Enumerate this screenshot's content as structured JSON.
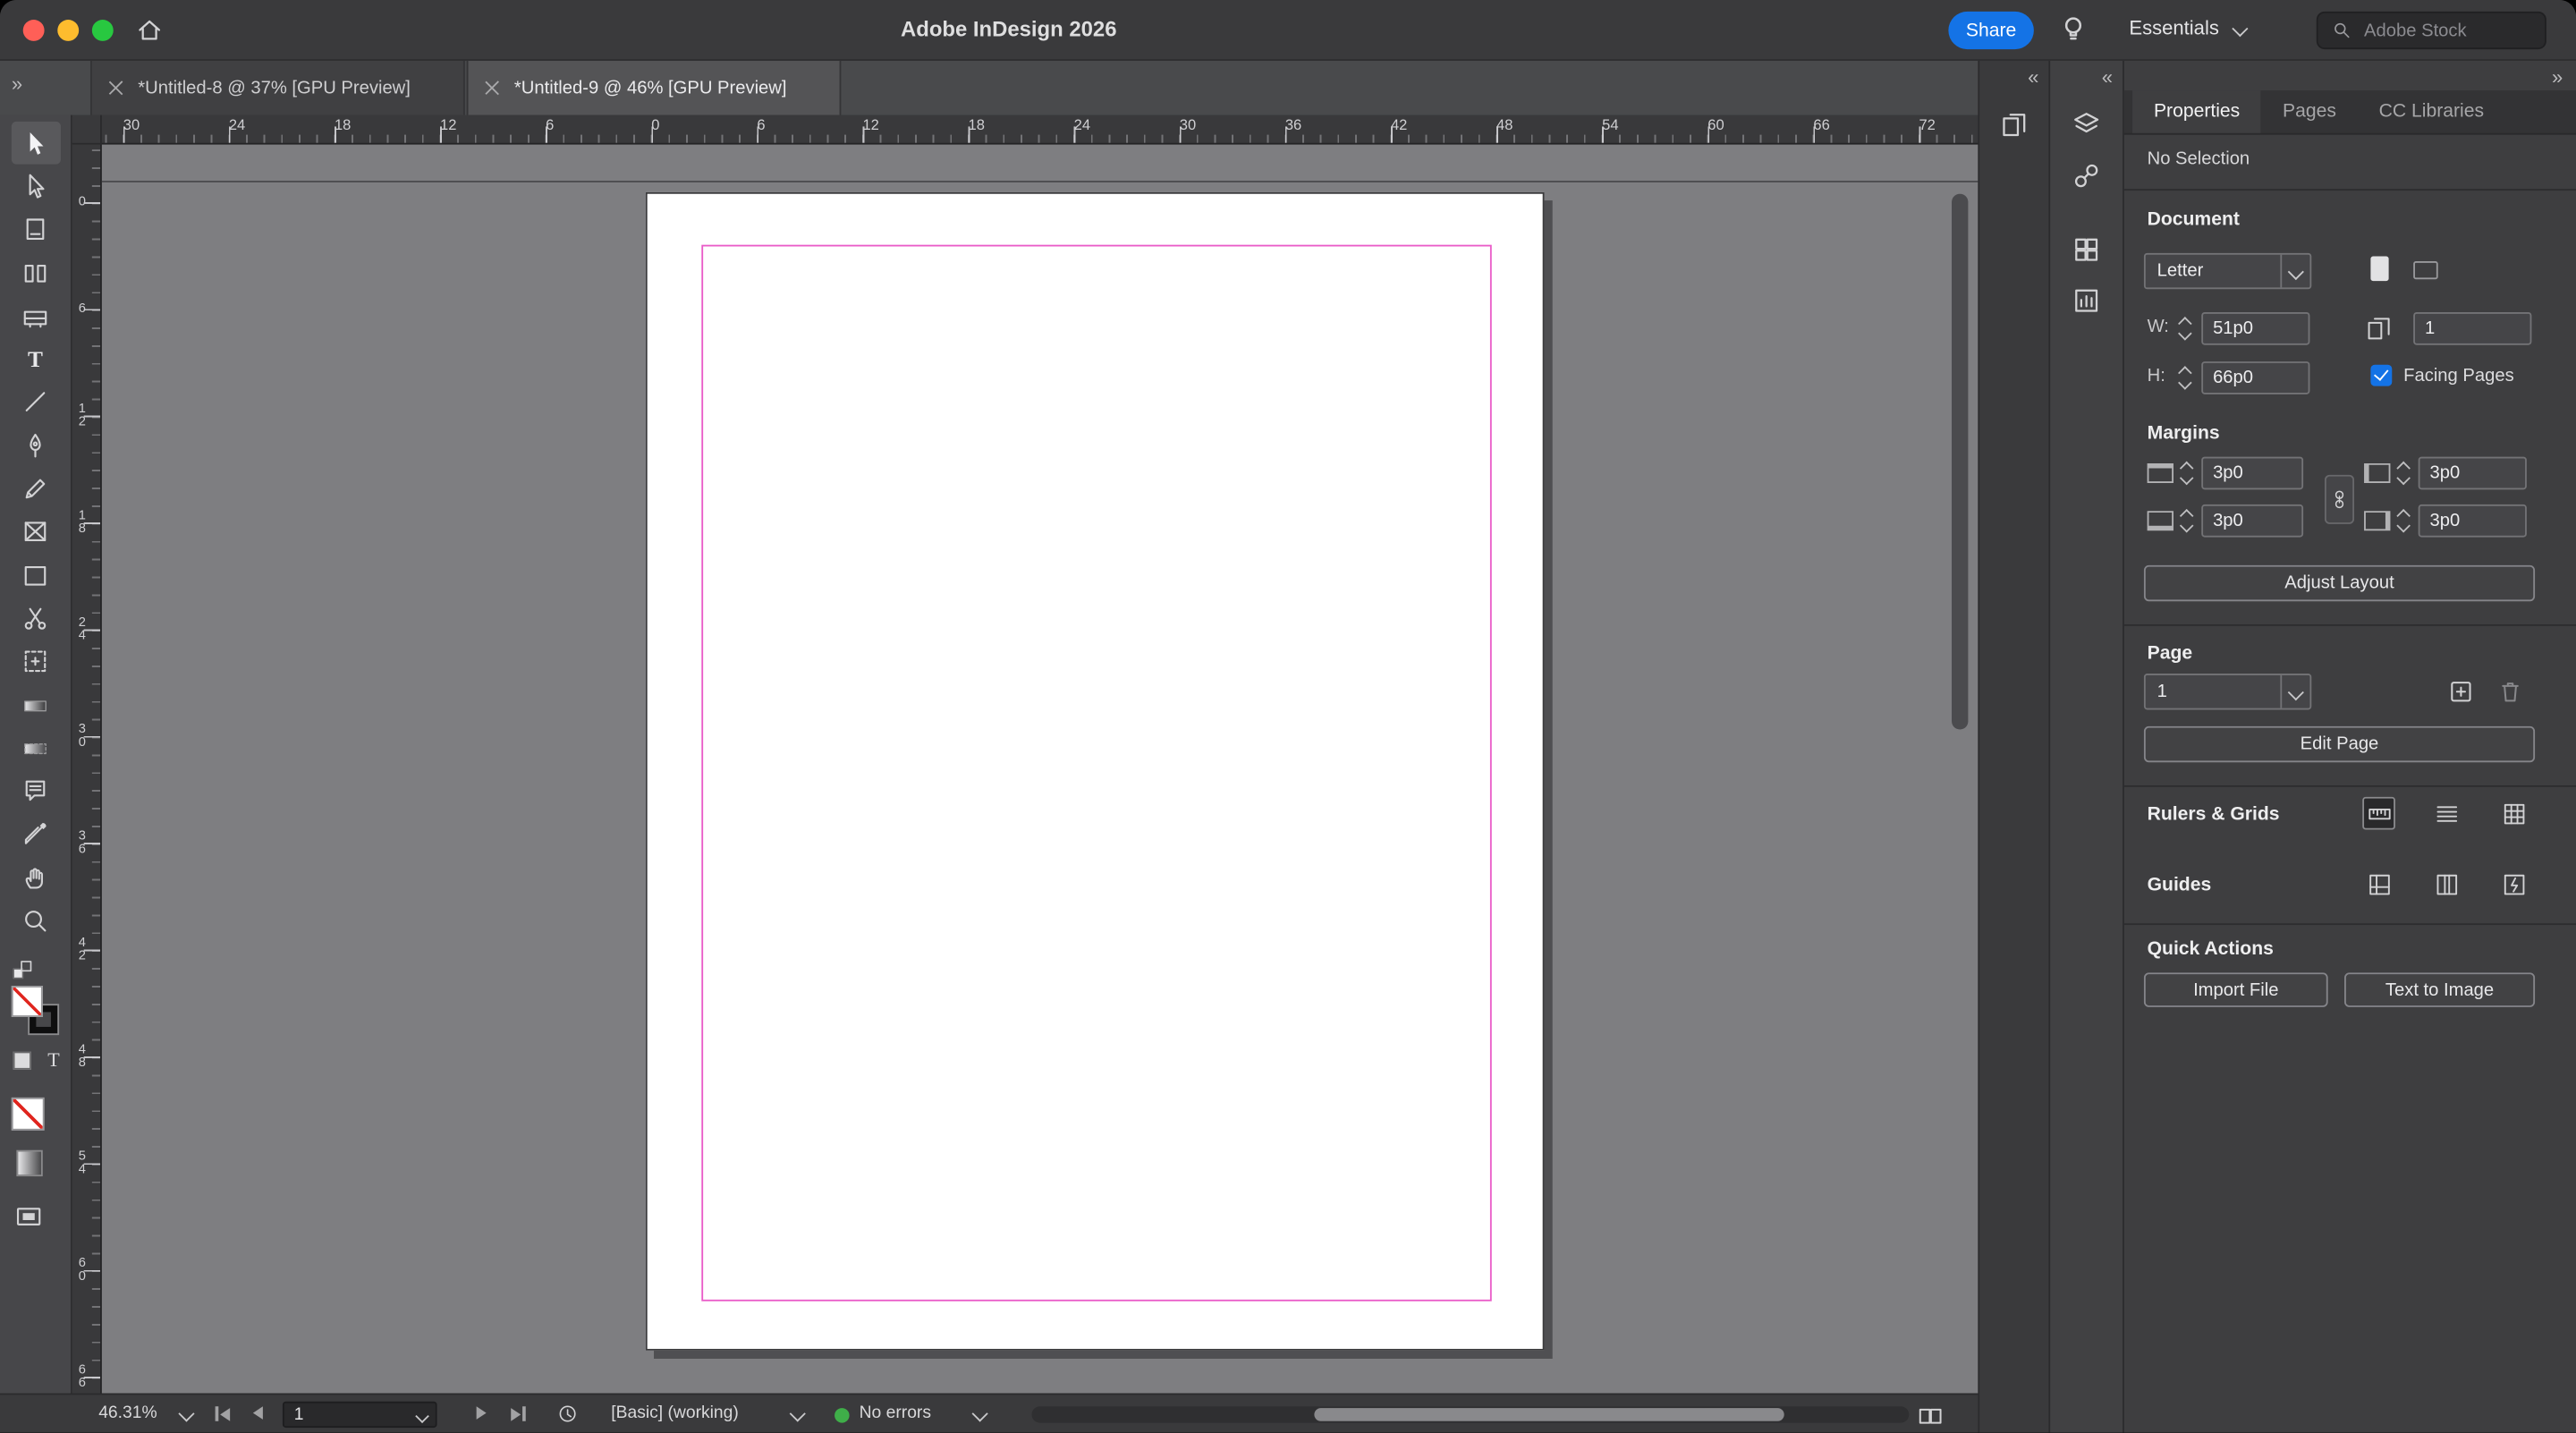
{
  "titlebar": {
    "title": "Adobe InDesign 2026",
    "share": "Share",
    "workspace": "Essentials",
    "stock_placeholder": "Adobe Stock"
  },
  "tabs": [
    {
      "label": "*Untitled-8 @ 37% [GPU Preview]",
      "active": false
    },
    {
      "label": "*Untitled-9 @ 46% [GPU Preview]",
      "active": true
    }
  ],
  "toolbar": {
    "tools": [
      "selection-tool-icon",
      "direct-selection-tool-icon",
      "page-tool-icon",
      "gap-tool-icon",
      "content-collector-tool-icon",
      "type-tool-icon",
      "line-tool-icon",
      "pen-tool-icon",
      "pencil-tool-icon",
      "rectangle-frame-tool-icon",
      "rectangle-tool-icon",
      "scissors-tool-icon",
      "free-transform-tool-icon",
      "gradient-swatch-tool-icon",
      "gradient-feather-tool-icon",
      "note-tool-icon",
      "eyedropper-tool-icon",
      "hand-tool-icon",
      "zoom-tool-icon"
    ],
    "extras": [
      "default-fill-stroke-icon",
      "fill-swatch-none",
      "stroke-swatch",
      "formatting-affects-container-icon",
      "formatting-affects-text-icon",
      "apply-none-button",
      "apply-gradient-button",
      "screen-mode-button"
    ]
  },
  "rulers": {
    "horizontal": [
      "30",
      "24",
      "18",
      "12",
      "6",
      "0",
      "6",
      "12",
      "18",
      "24",
      "30",
      "36",
      "42",
      "48",
      "54",
      "60",
      "66",
      "72"
    ],
    "vertical": [
      "0",
      "6",
      "12",
      "18",
      "24",
      "30",
      "36",
      "42",
      "48",
      "54",
      "60",
      "66"
    ]
  },
  "dock": {
    "strip_a_icons": [
      "pages-panel-icon"
    ],
    "strip_b_icons": [
      "layers-panel-icon",
      "links-panel-icon",
      "swatches-panel-icon",
      "cc-libraries-panel-icon"
    ]
  },
  "props": {
    "tabs": [
      "Properties",
      "Pages",
      "CC Libraries"
    ],
    "no_selection": "No Selection",
    "document": {
      "heading": "Document",
      "preset": "Letter",
      "w_label": "W:",
      "w_value": "51p0",
      "h_label": "H:",
      "h_value": "66p0",
      "pages_count": "1",
      "facing_pages": "Facing Pages"
    },
    "margins": {
      "heading": "Margins",
      "top": "3p0",
      "bottom": "3p0",
      "inside": "3p0",
      "outside": "3p0"
    },
    "adjust_layout": "Adjust Layout",
    "page": {
      "heading": "Page",
      "current": "1",
      "edit": "Edit Page"
    },
    "rulers_grids": {
      "label": "Rulers & Grids",
      "icons": [
        "ruler-icon",
        "baseline-grid-icon",
        "document-grid-icon"
      ]
    },
    "guides": {
      "label": "Guides",
      "icons": [
        "guides-icon",
        "column-guides-icon",
        "smart-guides-icon"
      ]
    },
    "quick": {
      "heading": "Quick Actions",
      "import": "Import File",
      "text_to_image": "Text to Image"
    }
  },
  "status": {
    "zoom": "46.31%",
    "page": "1",
    "profile": "[Basic] (working)",
    "errors": "No errors"
  },
  "colors": {
    "accent": "#1473e6",
    "margin_guide": "#ea5cc8",
    "preflight_ok": "#3fae49",
    "share_button": "#1473e6"
  }
}
